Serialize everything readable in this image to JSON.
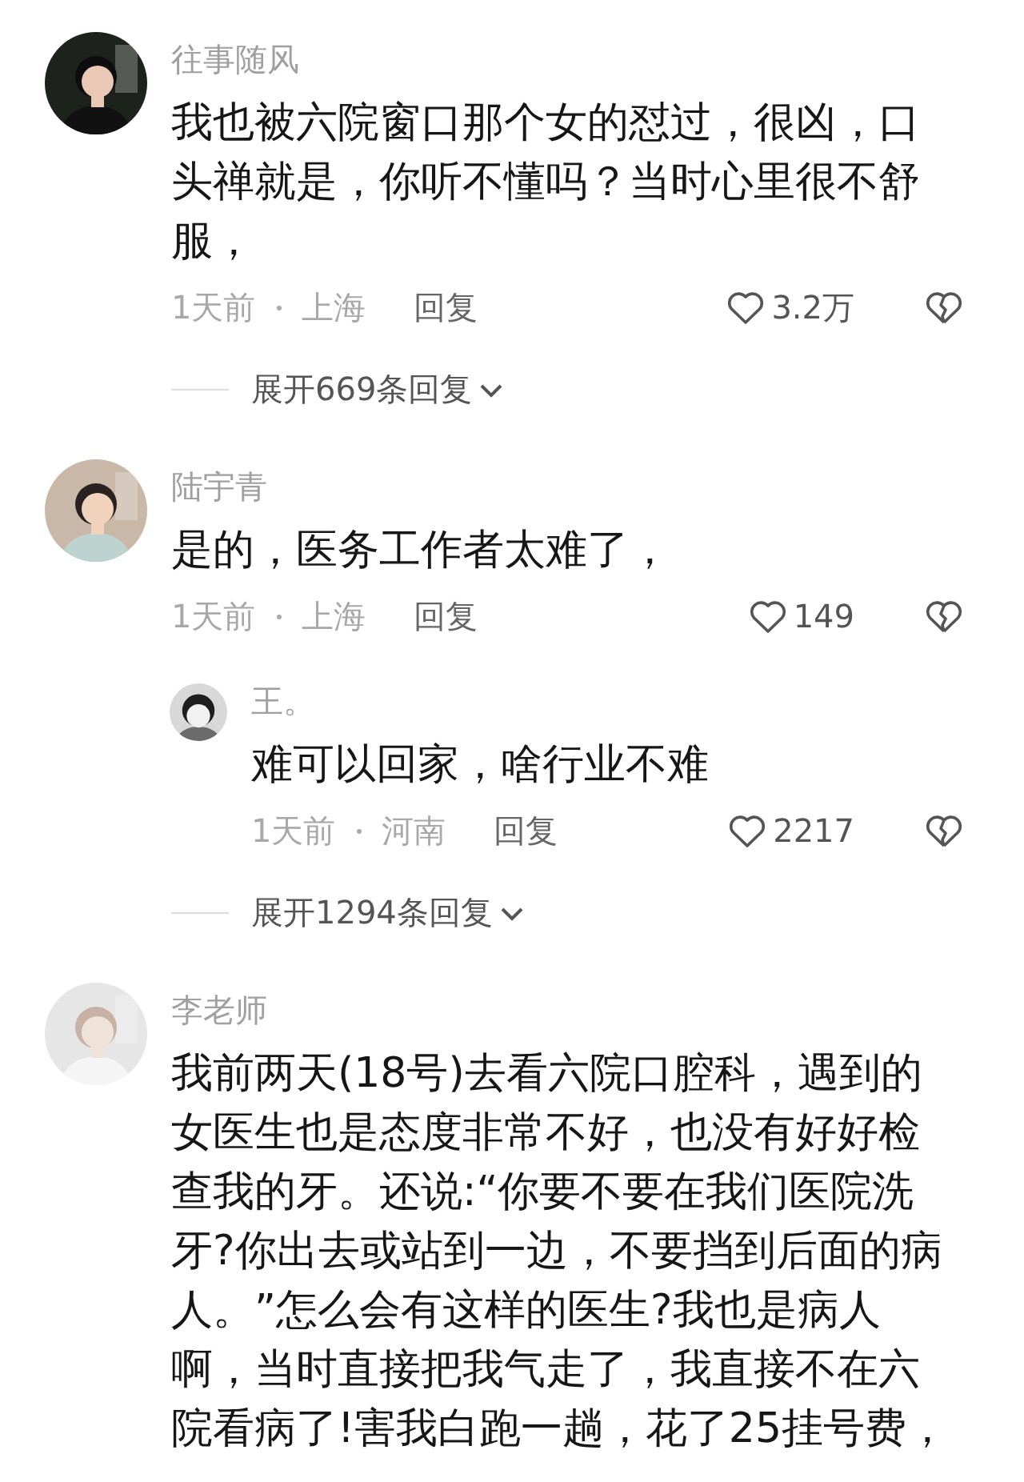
{
  "comments": [
    {
      "name": "往事随风",
      "text": "我也被六院窗口那个女的怼过，很凶，口头禅就是，你听不懂吗？当时心里很不舒服，",
      "time": "1天前",
      "location": "上海",
      "reply_label": "回复",
      "likes": "3.2万",
      "expand": "展开669条回复"
    },
    {
      "name": "陆宇青",
      "text": "是的，医务工作者太难了，",
      "time": "1天前",
      "location": "上海",
      "reply_label": "回复",
      "likes": "149",
      "replies": [
        {
          "name": "王。",
          "text": "难可以回家，啥行业不难",
          "time": "1天前",
          "location": "河南",
          "reply_label": "回复",
          "likes": "2217"
        }
      ],
      "expand": "展开1294条回复"
    },
    {
      "name": "李老师",
      "text": "我前两天(18号)去看六院口腔科，遇到的女医生也是态度非常不好，也没有好好检查我的牙。还说:“你要不要在我们医院洗牙?你出去或站到一边，不要挡到后面的病人。”怎么会有这样的医生?我也是病人啊，当时直接把我气走了，我直接不在六院看病了!害我白跑一趟，花了25挂号费，"
    }
  ]
}
